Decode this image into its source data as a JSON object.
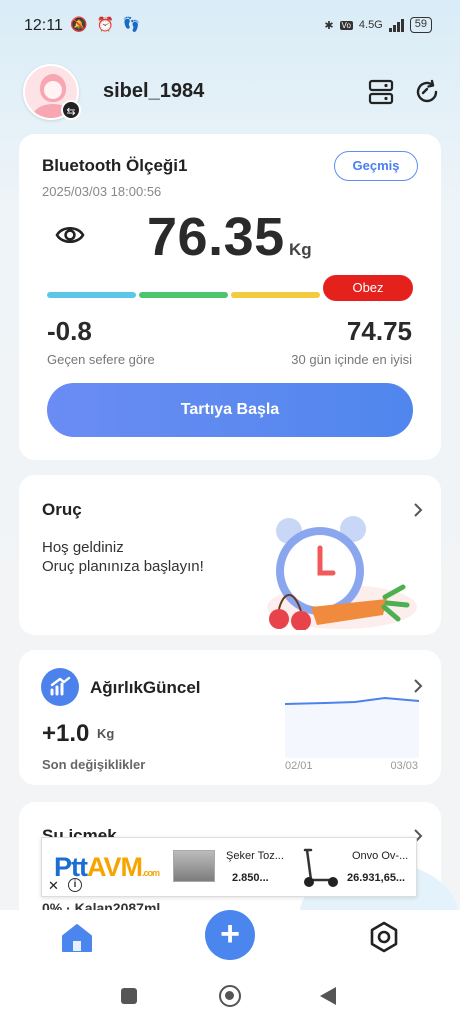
{
  "status_bar": {
    "time": "12:11",
    "network": "4.5G",
    "battery": "59"
  },
  "header": {
    "username": "sibel_1984"
  },
  "scale_card": {
    "device_name": "Bluetooth Ölçeği1",
    "datetime": "2025/03/03 18:00:56",
    "history_label": "Geçmiş",
    "weight_value": "76.35",
    "weight_unit": "Kg",
    "category_label": "Obez",
    "category_color": "#e5211e",
    "range_colors": [
      "#5cc6e6",
      "#4dc56e",
      "#f2cc3c",
      "#e5211e"
    ],
    "diff_value": "-0.8",
    "diff_label": "Geçen sefere göre",
    "best_value": "74.75",
    "best_label": "30 gün içinde en iyisi",
    "start_button": "Tartıya Başla"
  },
  "fasting_card": {
    "title": "Oruç",
    "line1": "Hoş geldiniz",
    "line2": "Oruç planınıza başlayın!"
  },
  "trend_card": {
    "title": "AğırlıkGüncel",
    "value": "+1.0",
    "unit": "Kg",
    "label": "Son değişiklikler",
    "x_start": "02/01",
    "x_end": "03/03",
    "accent_color": "#4b82ec"
  },
  "water_card": {
    "title": "Su içmek",
    "progress": "0% · Kalan2087ml"
  },
  "ad": {
    "product1_name": "Şeker Toz...",
    "product1_price": "2.850...",
    "product2_name": "Onvo Ov-...",
    "product2_price": "26.931,65..."
  }
}
